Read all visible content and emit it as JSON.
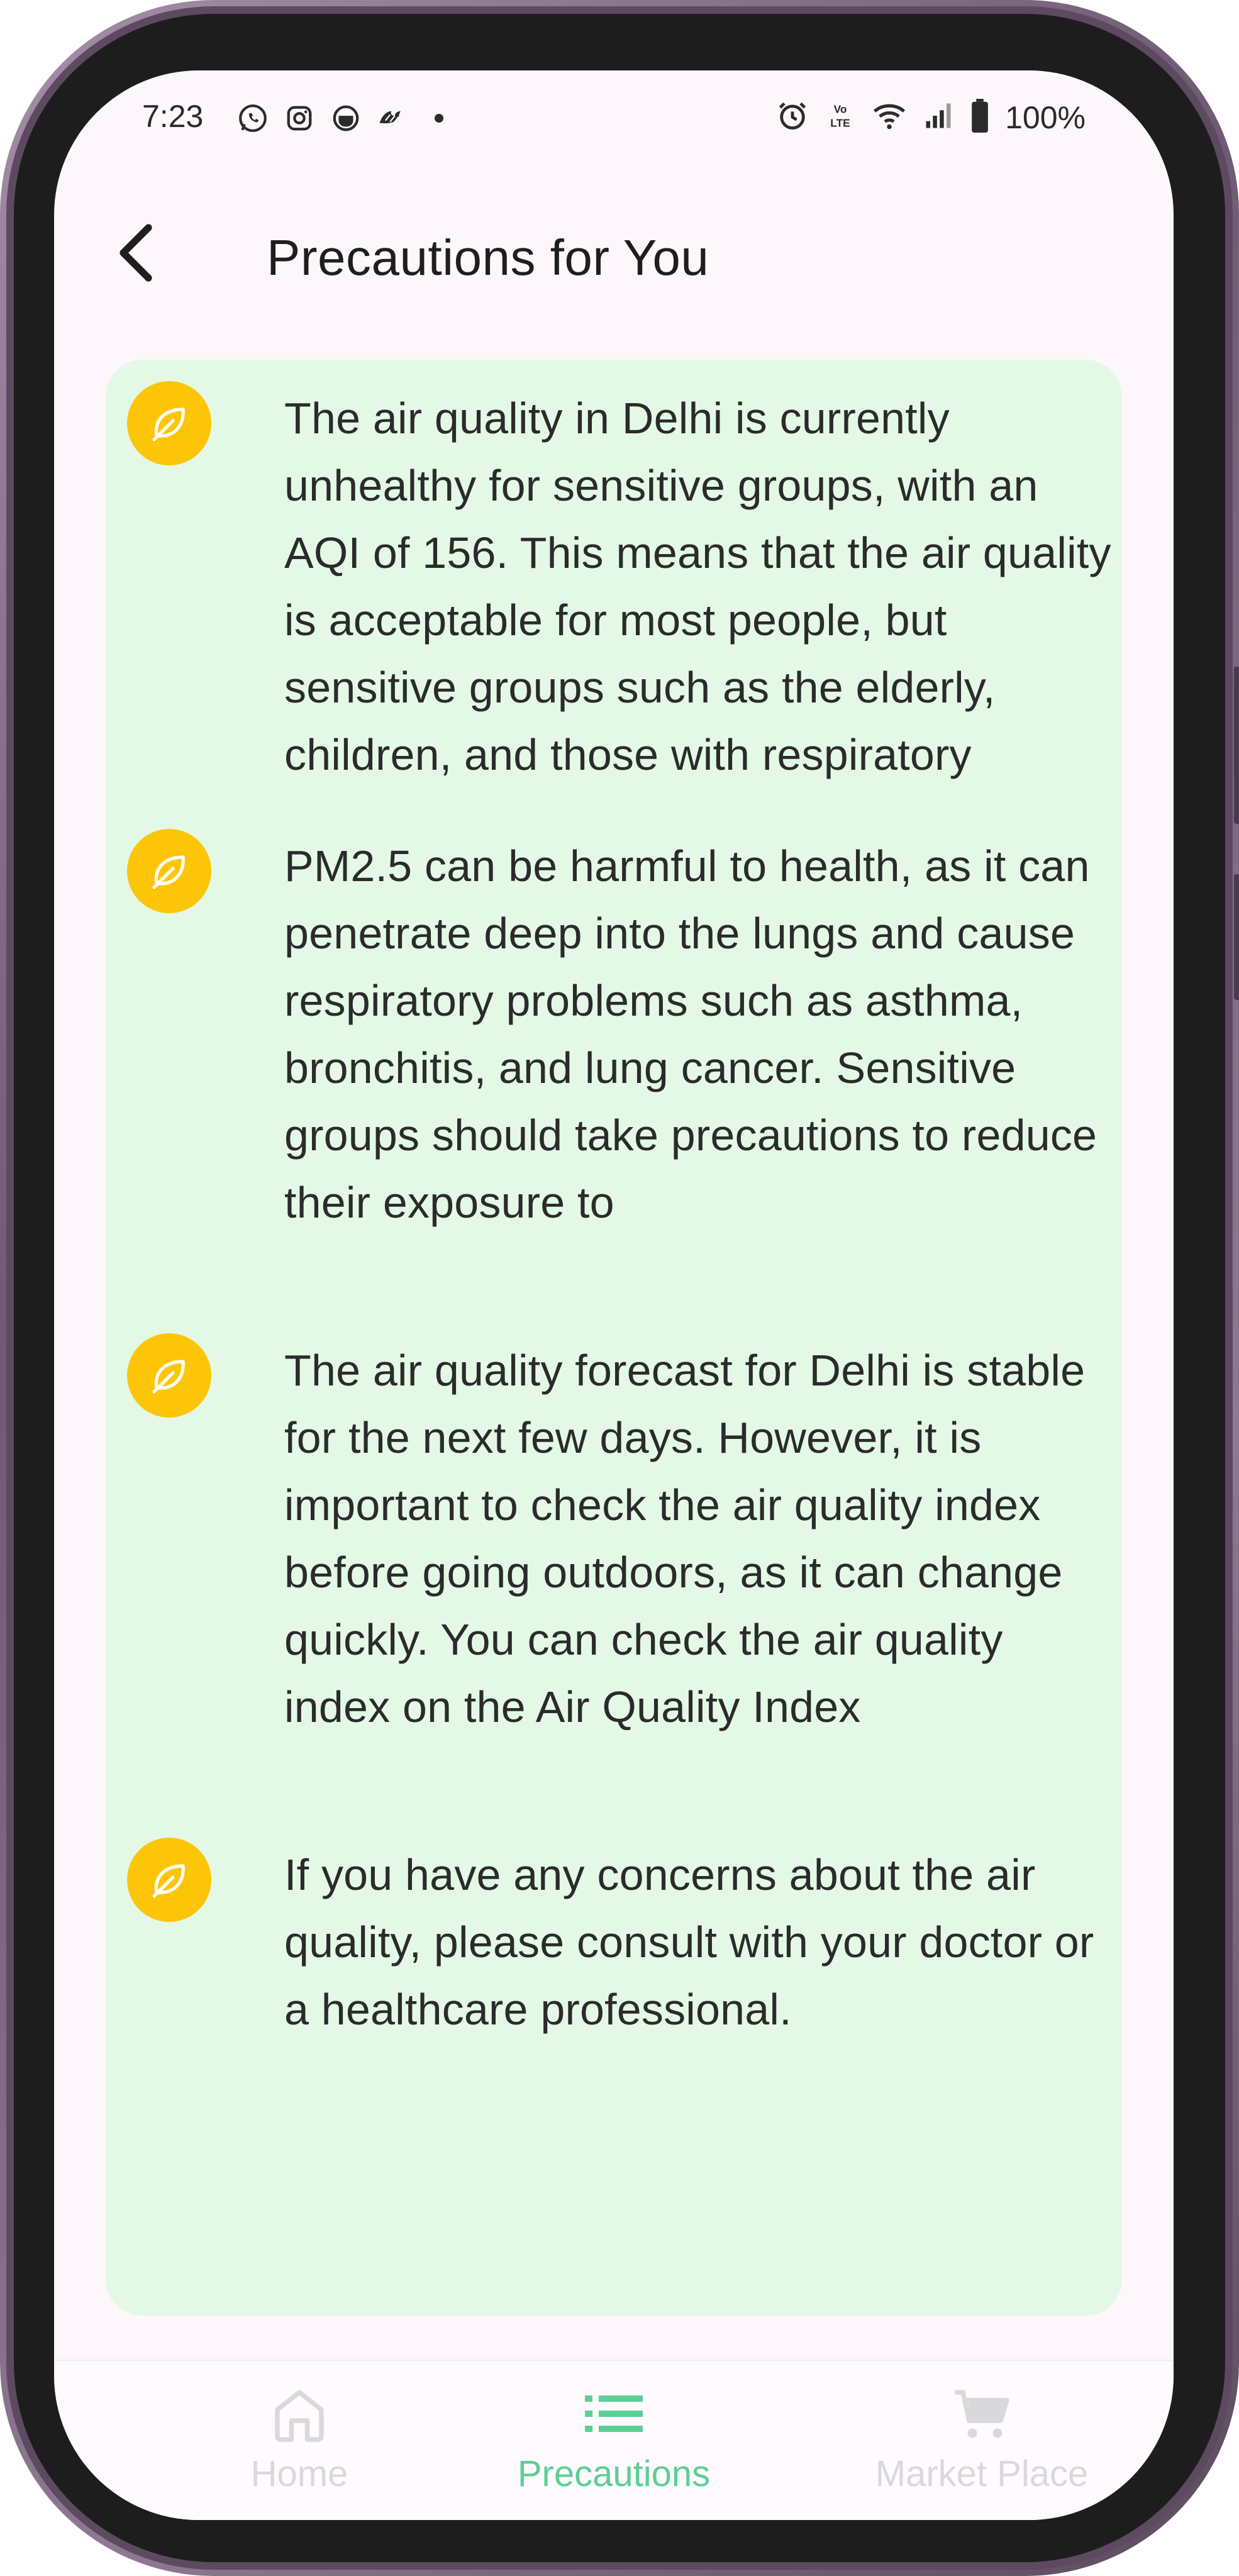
{
  "status_bar": {
    "time": "7:23",
    "left_icons": [
      "whatsapp-icon",
      "instagram-icon",
      "app-notification-icon",
      "app-notification-icon",
      "dot-icon"
    ],
    "right_icons": [
      "alarm-icon",
      "volte-icon",
      "wifi-icon",
      "signal-icon",
      "battery-icon"
    ],
    "volte_label": "VoLTE",
    "battery_percent": "100%"
  },
  "header": {
    "title": "Precautions for You",
    "back_icon": "chevron-left-icon"
  },
  "precautions": {
    "items": [
      {
        "icon": "leaf-icon",
        "text": "The air quality in Delhi is currently unhealthy for sensitive groups, with an AQI of 156. This means that the air quality is acceptable for most people, but sensitive groups such as the elderly, children, and those with respiratory"
      },
      {
        "icon": "leaf-icon",
        "text": "PM2.5 can be harmful to health, as it can penetrate deep into the lungs and cause respiratory problems such as asthma, bronchitis, and lung cancer. Sensitive groups should take precautions to reduce their exposure to"
      },
      {
        "icon": "leaf-icon",
        "text": "The air quality forecast for Delhi is stable for the next few days. However, it is important to check the air quality index before going outdoors, as it can change quickly. You can check the air quality index on the Air Quality Index"
      },
      {
        "icon": "leaf-icon",
        "text": "If you have any concerns about the air quality, please consult with your doctor or a healthcare professional."
      }
    ]
  },
  "bottom_nav": {
    "items": [
      {
        "label": "Home",
        "icon": "home-icon",
        "active": false
      },
      {
        "label": "Precautions",
        "icon": "list-icon",
        "active": true
      },
      {
        "label": "Market Place",
        "icon": "cart-icon",
        "active": false
      }
    ]
  },
  "colors": {
    "card_background": "#e3f9e6",
    "badge_yellow": "#fdc507",
    "active_nav": "#5ccf95",
    "inactive_nav": "#d9d9dc",
    "screen_background": "#fdf7fb"
  }
}
